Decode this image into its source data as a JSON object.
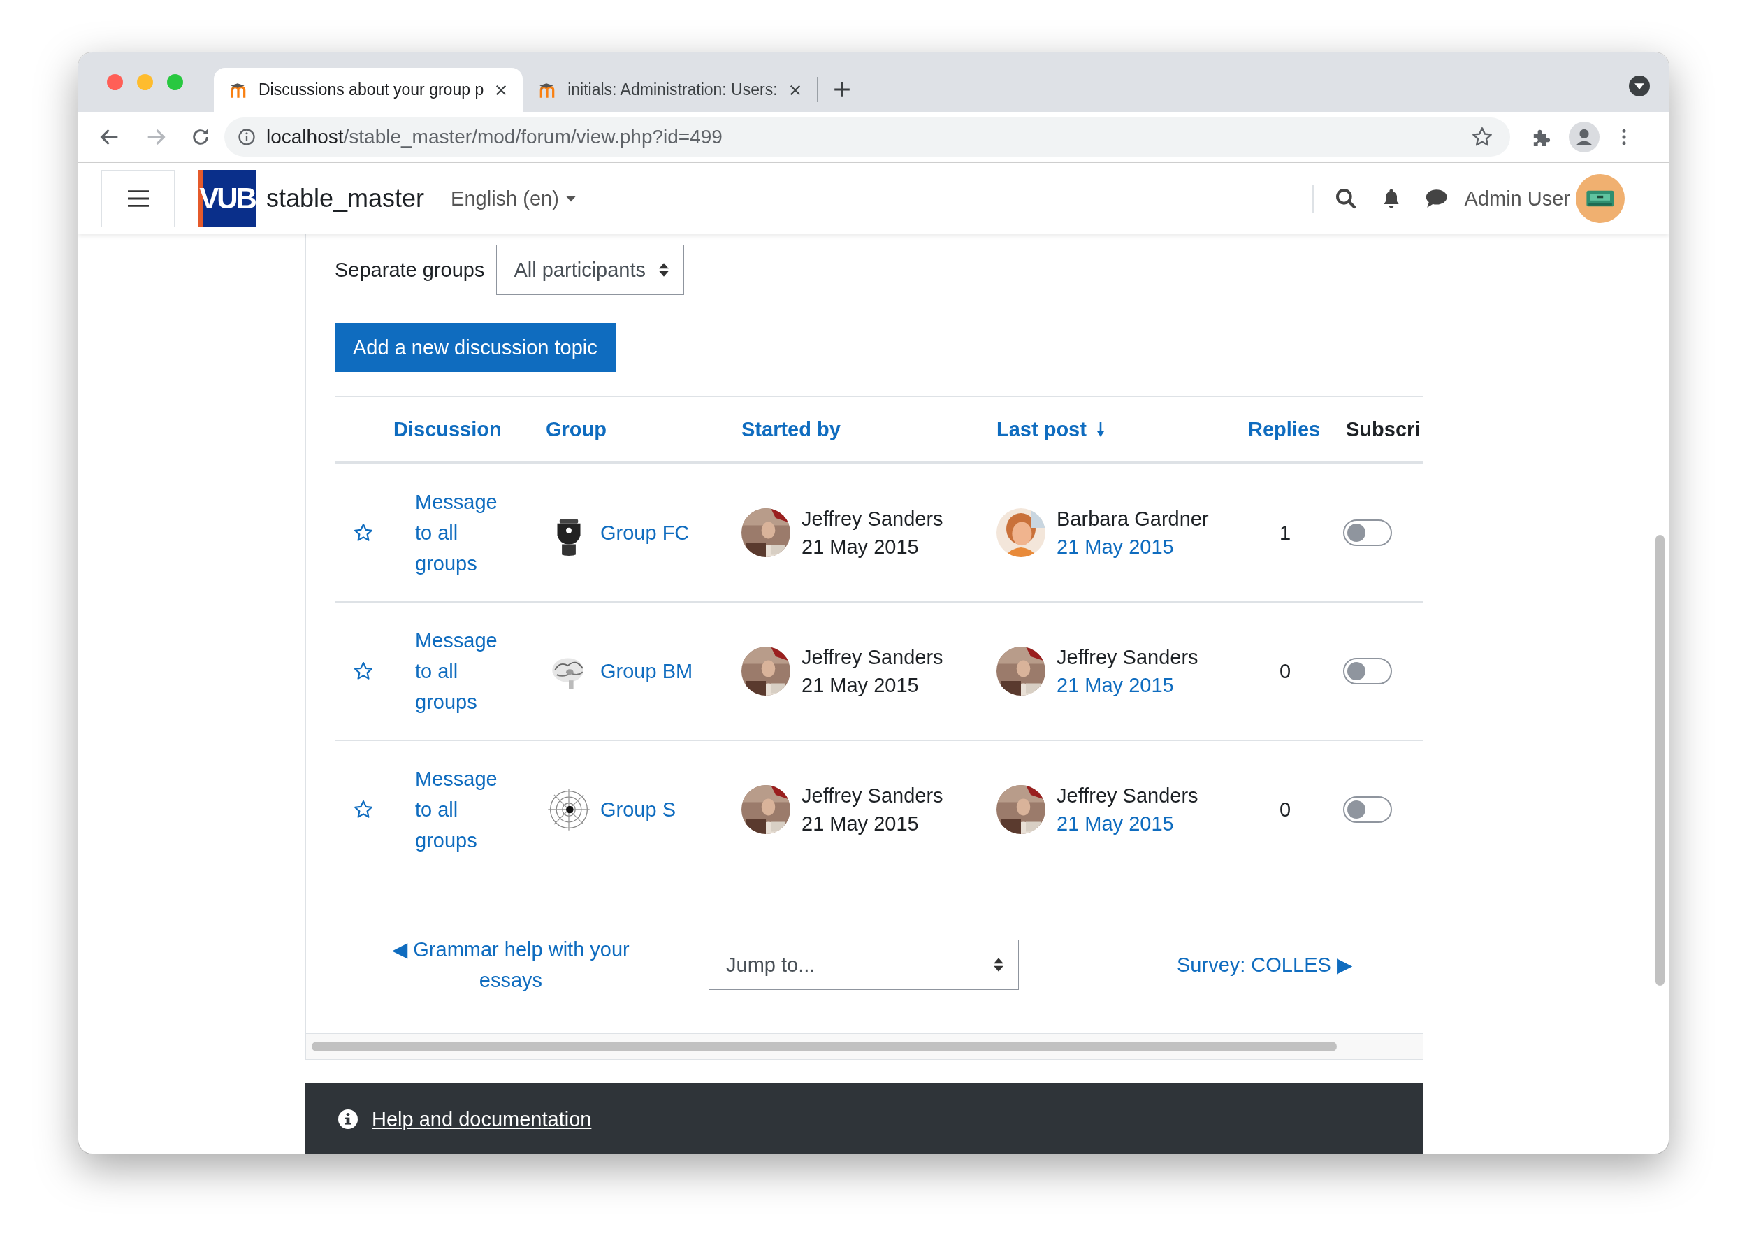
{
  "browser": {
    "tabs": [
      {
        "title": "Discussions about your group p",
        "selected": true
      },
      {
        "title": "initials: Administration: Users:",
        "selected": false
      }
    ],
    "address": {
      "host": "localhost",
      "path": "/stable_master/mod/forum/view.php?id=499"
    }
  },
  "navbar": {
    "logo": "VUB",
    "site_name": "stable_master",
    "language": "English (en)",
    "user_name": "Admin User"
  },
  "group_filter": {
    "label": "Separate groups",
    "value": "All participants"
  },
  "add_button": "Add a new discussion topic",
  "table": {
    "columns": [
      {
        "label": "Discussion",
        "kind": "link"
      },
      {
        "label": "Group",
        "kind": "link"
      },
      {
        "label": "Started by",
        "kind": "link"
      },
      {
        "label": "Last post",
        "kind": "sorted"
      },
      {
        "label": "Replies",
        "kind": "link"
      },
      {
        "label": "Subscri",
        "kind": "plain"
      }
    ],
    "rows": [
      {
        "starred": false,
        "discussion": "Message to all groups",
        "group": "Group FC",
        "started_by": "Jeffrey Sanders",
        "started": "21 May 2015",
        "last_post_by": "Barbara Gardner",
        "last_post": "21 May 2015",
        "replies": "1",
        "subscribed": false
      },
      {
        "starred": false,
        "discussion": "Message to all groups",
        "group": "Group BM",
        "started_by": "Jeffrey Sanders",
        "started": "21 May 2015",
        "last_post_by": "Jeffrey Sanders",
        "last_post": "21 May 2015",
        "replies": "0",
        "subscribed": false
      },
      {
        "starred": false,
        "discussion": "Message to all groups",
        "group": "Group S",
        "started_by": "Jeffrey Sanders",
        "started": "21 May 2015",
        "last_post_by": "Jeffrey Sanders",
        "last_post": "21 May 2015",
        "replies": "0",
        "subscribed": false
      }
    ]
  },
  "activity_nav": {
    "previous": "◀ Grammar help with your essays",
    "jump": "Jump to...",
    "next": "Survey: COLLES ▶"
  },
  "footer": {
    "help_link": "Help and documentation"
  }
}
